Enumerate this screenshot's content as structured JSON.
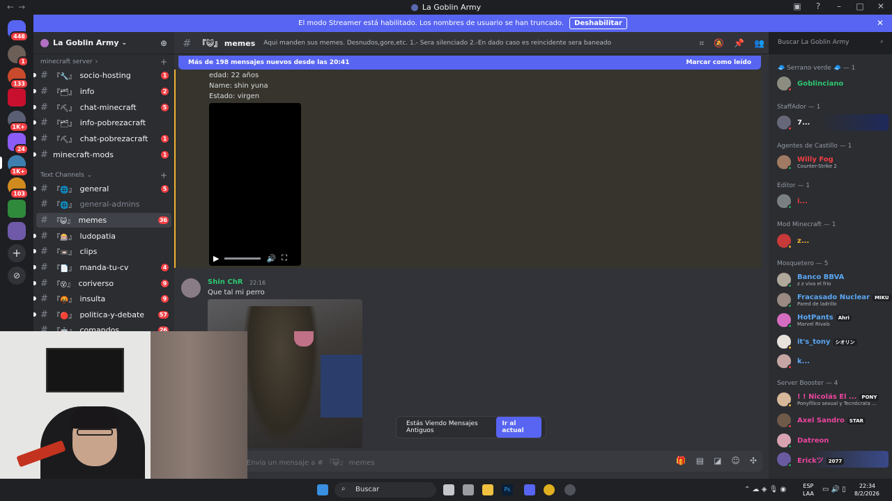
{
  "titlebar": {
    "title": "La Goblin Army",
    "back": "←",
    "forward": "→"
  },
  "banner": {
    "text": "El modo Streamer está habilitado. Los nombres de usuario se han truncado.",
    "button": "Deshabilitar"
  },
  "servers": {
    "home_badge": "448",
    "badges": [
      "1",
      "133",
      "1K+",
      "1K+",
      "24",
      "1K+",
      "103"
    ]
  },
  "sidebar": {
    "guild_name": "La Goblin Army",
    "cat1": "minecraft server",
    "cat1_channels": [
      {
        "icon": "『🔧』",
        "name": "socio-hosting",
        "badge": "1"
      },
      {
        "icon": "『🗂』",
        "name": "info",
        "badge": "2"
      },
      {
        "icon": "『⛏』",
        "name": "chat-minecraft",
        "badge": "5"
      },
      {
        "icon": "『🗂』",
        "name": "info-pobrezacraft",
        "badge": ""
      },
      {
        "icon": "『⛏』",
        "name": "chat-pobrezacraft",
        "badge": "1"
      },
      {
        "icon": "",
        "name": "minecraft-mods",
        "badge": "1"
      }
    ],
    "cat2": "Text Channels",
    "cat2_channels": [
      {
        "icon": "『🌐』",
        "name": "general",
        "badge": "5"
      },
      {
        "icon": "『🌐』",
        "name": "general-admins",
        "badge": ""
      },
      {
        "icon": "『😺』",
        "name": "memes",
        "badge": "36"
      },
      {
        "icon": "『🎰』",
        "name": "ludopatia",
        "badge": ""
      },
      {
        "icon": "『📼』",
        "name": "clips",
        "badge": ""
      },
      {
        "icon": "『📄』",
        "name": "manda-tu-cv",
        "badge": "4"
      },
      {
        "icon": "『😵』",
        "name": "coriverso",
        "badge": "9"
      },
      {
        "icon": "『🤬』",
        "name": "insulta",
        "badge": "9"
      },
      {
        "icon": "『🔴』",
        "name": "politica-y-debate",
        "badge": "57"
      },
      {
        "icon": "『🤖』",
        "name": "comandos",
        "badge": "26"
      }
    ]
  },
  "header": {
    "channel": "『😺』 memes",
    "topic": "Aqui manden sus memes. Desnudos,gore,etc. 1.- Sera silenciado 2.-En dado caso es reincidente sera baneado",
    "search_placeholder": "Buscar La Goblin Army"
  },
  "chat": {
    "new_bar": "Más de 198 mensajes nuevos desde las 20:41",
    "mark_read": "Marcar como leído",
    "lines": [
      "edad: 22 años",
      "Name: shin yuna",
      "Estado: virgen"
    ],
    "msg2_author": "Shin ChR",
    "msg2_time": "22:16",
    "msg2_text": "Que tal mi perro",
    "old_msgs": "Estás Viendo Mensajes Antiguos",
    "go_current": "Ir al actual",
    "composer_placeholder": "Envía un mensaje a # 『😺』 memes"
  },
  "members": {
    "roles": [
      {
        "label": "🧢 Serrano verde 🧢 — 1"
      },
      {
        "label": "StaffAdor — 1"
      },
      {
        "label": "Agentes de Castillo — 1"
      },
      {
        "label": "Editor — 1"
      },
      {
        "label": "Mod Minecraft — 1"
      },
      {
        "label": "Mosquetero — 5"
      },
      {
        "label": "Server Booster — 4"
      }
    ],
    "list": [
      {
        "name": "Goblinciano",
        "sub": "",
        "tag": "",
        "color": "#2dc770"
      },
      {
        "name": "7...",
        "sub": "",
        "tag": "",
        "color": "#f2f3f5"
      },
      {
        "name": "Willy Fog",
        "sub": "Counter-Strike 2",
        "tag": "",
        "color": "#f23f43"
      },
      {
        "name": "i...",
        "sub": "",
        "tag": "",
        "color": "#f23f43"
      },
      {
        "name": "z...",
        "sub": "",
        "tag": "",
        "color": "#f0b232"
      },
      {
        "name": "Banco BBVA",
        "sub": "z z viva el frio",
        "tag": "",
        "color": "#5ba6f2"
      },
      {
        "name": "Fracasado Nuclear",
        "sub": "Pared de ladrillo",
        "tag": "MIKU",
        "color": "#5ba6f2"
      },
      {
        "name": "HotPants",
        "sub": "Marvel Rivals",
        "tag": "Ahri",
        "color": "#5ba6f2"
      },
      {
        "name": "it's_tony",
        "sub": "",
        "tag": "シオリン",
        "color": "#5ba6f2"
      },
      {
        "name": "k...",
        "sub": "",
        "tag": "",
        "color": "#5ba6f2"
      },
      {
        "name": "! ! Nicolás El ...",
        "sub": "Ponyfílico sexual y Tecnócrata ...",
        "tag": "PONY",
        "color": "#eb459e"
      },
      {
        "name": "Axel Sandro",
        "sub": "",
        "tag": "STAR",
        "color": "#eb459e"
      },
      {
        "name": "Datreon",
        "sub": "",
        "tag": "",
        "color": "#eb459e"
      },
      {
        "name": "Erickツ",
        "sub": "",
        "tag": "2077",
        "color": "#eb459e"
      }
    ]
  },
  "taskbar": {
    "search": "Buscar",
    "lang1": "ESP",
    "lang2": "LAA",
    "time": "22:34",
    "date": "8/2/2026"
  }
}
